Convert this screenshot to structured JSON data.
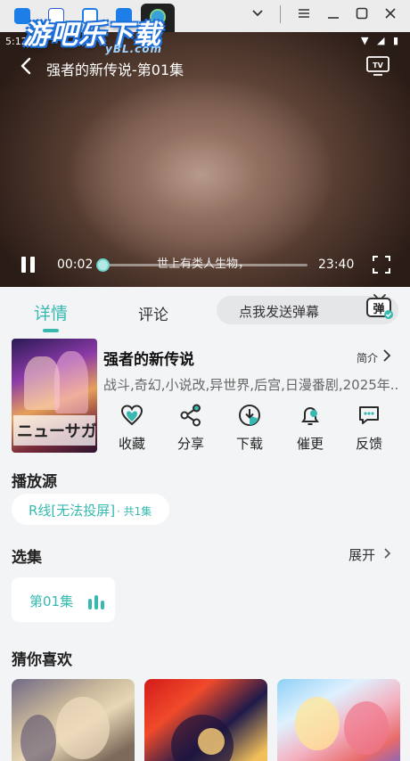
{
  "browser": {
    "logo_text": "游吧乐下载",
    "logo_sub": "yBL.com"
  },
  "statusbar": {
    "time": "5:12",
    "icons": "▼ ◢ ▮"
  },
  "player": {
    "title": "强者的新传说-第01集",
    "subtitle": "世上有类人生物，",
    "current_time": "00:02",
    "total_time": "23:40",
    "progress": 0.0014
  },
  "tabs": {
    "detail": "详情",
    "comment": "评论",
    "danmaku_placeholder": "点我发送弹幕",
    "danmaku_icon_text": "弹"
  },
  "info": {
    "title": "强者的新传说",
    "intro_label": "简介",
    "tags": "战斗,奇幻,小说改,异世界,后宫,日漫番剧,2025年...",
    "cover_text": "ニューサガ"
  },
  "actions": [
    {
      "label": "收藏",
      "icon": "heart-icon"
    },
    {
      "label": "分享",
      "icon": "share-icon"
    },
    {
      "label": "下载",
      "icon": "download-icon"
    },
    {
      "label": "催更",
      "icon": "bell-icon"
    },
    {
      "label": "反馈",
      "icon": "feedback-icon"
    }
  ],
  "play_source": {
    "heading": "播放源",
    "name": "R线[无法投屏]",
    "count": "· 共1集"
  },
  "episodes": {
    "heading": "选集",
    "expand_label": "展开",
    "items": [
      {
        "label": "第01集"
      }
    ]
  },
  "recommend": {
    "heading": "猜你喜欢"
  },
  "colors": {
    "accent": "#37b9b1",
    "background": "#f3f4f6"
  }
}
